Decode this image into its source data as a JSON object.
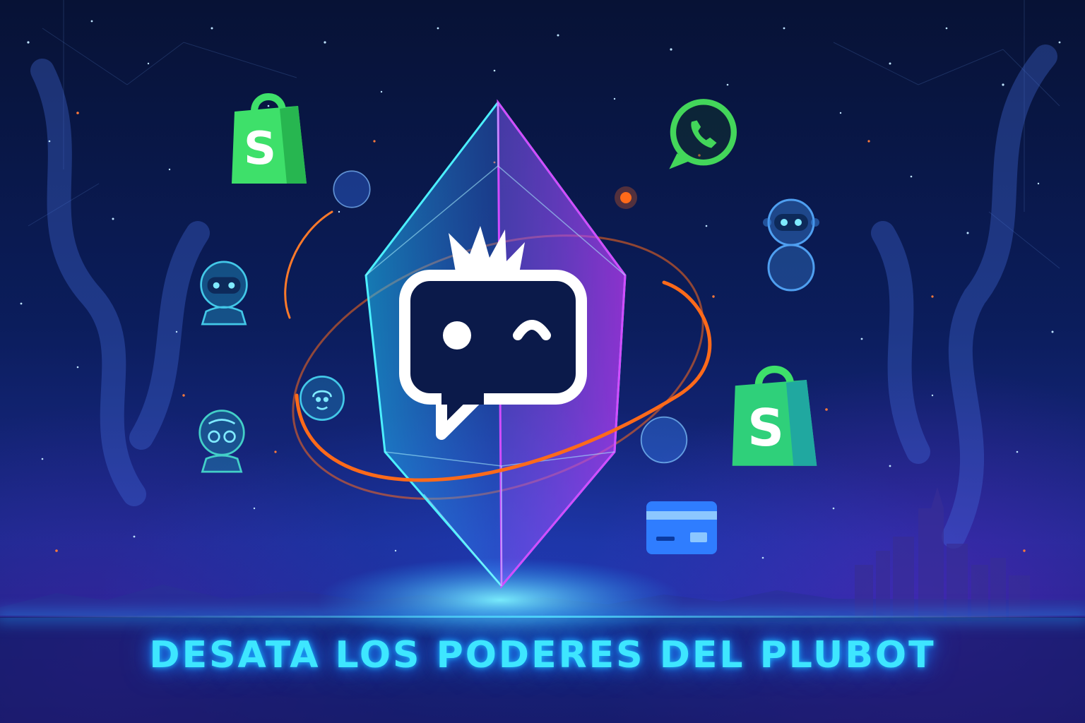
{
  "banner": {
    "title": "DESATA LOS PODERES DEL PLUBOT"
  },
  "icons": {
    "central": "plubot-chat-icon",
    "crystal": "crystal-icon",
    "shop_top": "shopify-bag-icon",
    "shop_right": "shopify-bag-icon",
    "whatsapp": "whatsapp-icon",
    "card": "credit-card-icon",
    "robots": [
      "robot-head-icon",
      "robot-head-icon",
      "robot-face-icon",
      "robot-figure-icon"
    ]
  },
  "colors": {
    "background": "#0b1d5c",
    "title": "#3ee6ff",
    "orbit": "#ff6a1a",
    "shop_green": "#3ee06a",
    "whatsapp_green": "#43d65a",
    "crystal_cyan": "#4cf0ff",
    "crystal_magenta": "#c23cff"
  }
}
